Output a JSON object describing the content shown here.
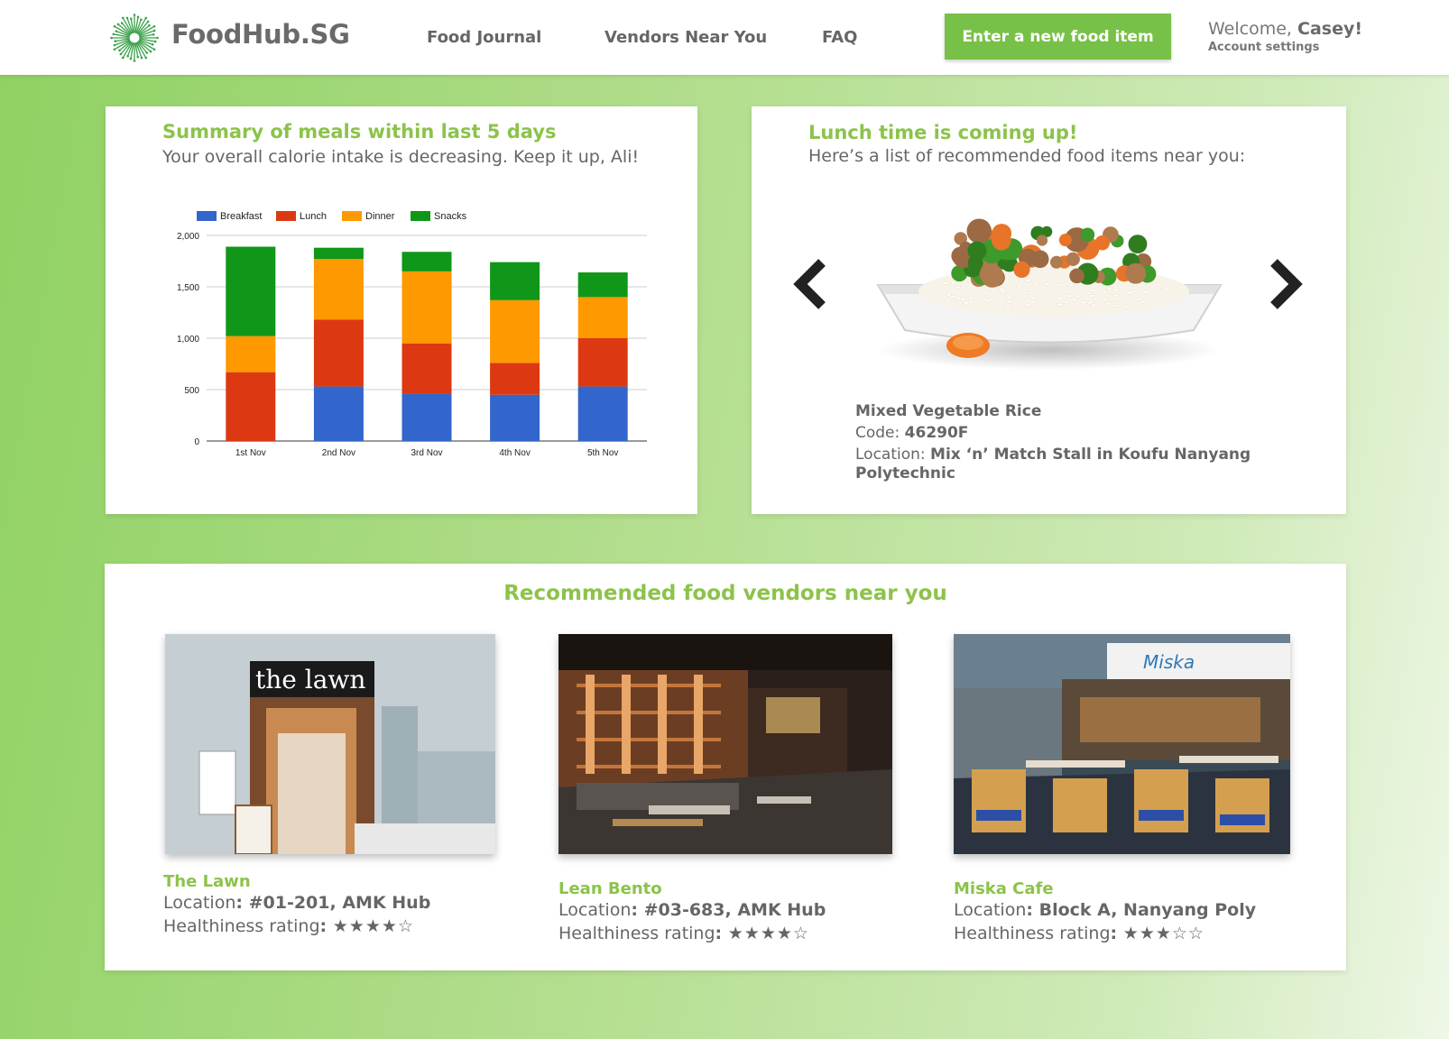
{
  "header": {
    "brand": "FoodHub.SG",
    "nav": [
      "Food Journal",
      "Vendors Near You",
      "FAQ"
    ],
    "cta": "Enter a new food item",
    "welcome_prefix": "Welcome, ",
    "user_name": "Casey!",
    "account_settings": "Account settings",
    "accent_color": "#78c148",
    "icon": "starburst-logo-icon"
  },
  "summary": {
    "title": "Summary of meals within last 5 days",
    "subtitle": "Your overall calorie intake is decreasing. Keep it up, Ali!"
  },
  "chart_data": {
    "type": "bar",
    "stacked": true,
    "categories": [
      "1st Nov",
      "2nd Nov",
      "3rd Nov",
      "4th Nov",
      "5th Nov"
    ],
    "series": [
      {
        "name": "Breakfast",
        "color": "#3366cc",
        "values": [
          0,
          530,
          460,
          450,
          530
        ]
      },
      {
        "name": "Lunch",
        "color": "#dc3912",
        "values": [
          670,
          650,
          490,
          310,
          470
        ]
      },
      {
        "name": "Dinner",
        "color": "#ff9900",
        "values": [
          350,
          590,
          700,
          610,
          400
        ]
      },
      {
        "name": "Snacks",
        "color": "#109618",
        "values": [
          870,
          110,
          190,
          370,
          240
        ]
      }
    ],
    "yticks": [
      "0",
      "500",
      "1,000",
      "1,500",
      "2,000"
    ],
    "ylim": [
      0,
      2000
    ],
    "legend_position": "top-left",
    "grid": true
  },
  "lunch": {
    "title": "Lunch time is coming up!",
    "subtitle": "Here’s a list of recommended food items near you:",
    "food_name": "Mixed Vegetable Rice",
    "code_label": "Code: ",
    "code": "46290F",
    "location_label": "Location: ",
    "location": "Mix ‘n’ Match Stall in Koufu Nanyang Polytechnic",
    "prev_icon": "chevron-left-icon",
    "next_icon": "chevron-right-icon"
  },
  "vendors": {
    "title": "Recommended food vendors near you",
    "items": [
      {
        "name": "The Lawn",
        "location_label": "Location",
        "location": ": #01-201, AMK Hub",
        "rating_label": "Healthiness rating",
        "rating_sep": ": ",
        "stars": "★★★★☆",
        "rating": 4
      },
      {
        "name": "Lean Bento",
        "location_label": "Location",
        "location": ": #03-683, AMK Hub",
        "rating_label": "Healthiness rating",
        "rating_sep": ": ",
        "stars": "★★★★☆",
        "rating": 4
      },
      {
        "name": "Miska Cafe",
        "location_label": "Location",
        "location": ": Block A, Nanyang Poly",
        "rating_label": "Healthiness rating",
        "rating_sep": ": ",
        "stars": "★★★☆☆",
        "rating": 3
      }
    ],
    "sign_the_lawn": "the lawn",
    "sign_miska": "Miska"
  }
}
